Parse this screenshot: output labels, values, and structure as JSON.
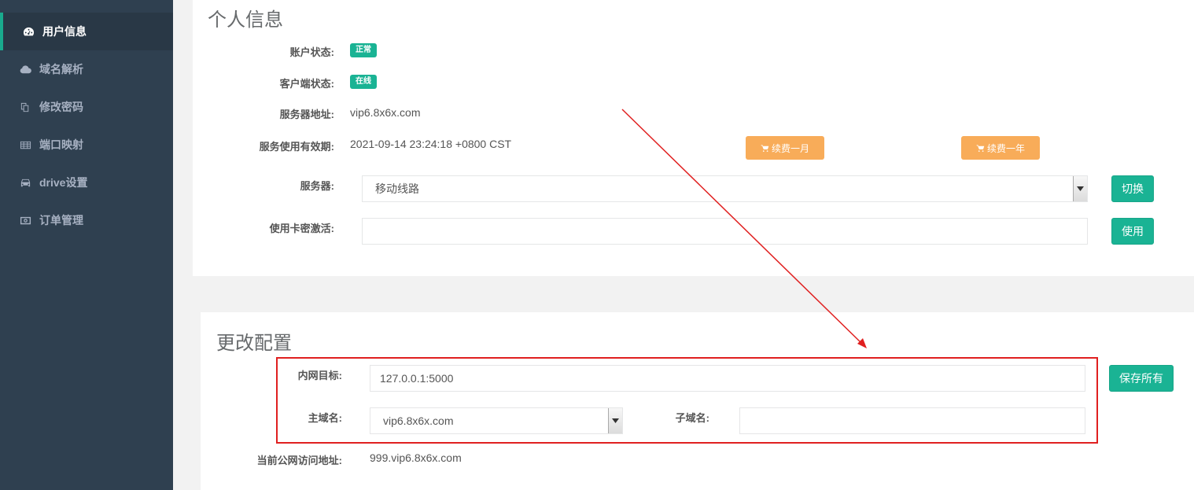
{
  "sidebar": {
    "items": [
      {
        "label": "用户信息",
        "icon": "dashboard-icon",
        "active": true
      },
      {
        "label": "域名解析",
        "icon": "cloud-icon"
      },
      {
        "label": "修改密码",
        "icon": "copy-icon"
      },
      {
        "label": "端口映射",
        "icon": "table-icon"
      },
      {
        "label": "drive设置",
        "icon": "car-icon"
      },
      {
        "label": "订单管理",
        "icon": "money-icon"
      }
    ]
  },
  "profile": {
    "title": "个人信息",
    "account_status_label": "账户状态:",
    "account_status_badge": "正常",
    "client_status_label": "客户端状态:",
    "client_status_badge": "在线",
    "server_address_label": "服务器地址:",
    "server_address": "vip6.8x6x.com",
    "expiry_label": "服务使用有效期:",
    "expiry": "2021-09-14 23:24:18 +0800 CST",
    "renew_month": "续费一月",
    "renew_year": "续费一年",
    "server_label": "服务器:",
    "server_selected": "移动线路",
    "switch_button": "切换",
    "card_label": "使用卡密激活:",
    "card_value": "",
    "use_button": "使用"
  },
  "config": {
    "title": "更改配置",
    "target_label": "内网目标:",
    "target_value": "127.0.0.1:5000",
    "save_button": "保存所有",
    "main_domain_label": "主域名:",
    "main_domain_selected": "vip6.8x6x.com",
    "subdomain_label": "子域名:",
    "subdomain_value": "",
    "public_url_label": "当前公网访问地址:",
    "public_url": "999.vip6.8x6x.com"
  },
  "colors": {
    "sidebar_bg": "#2f4050",
    "accent_green": "#1ab394",
    "accent_orange": "#f8ac59",
    "annotation_red": "#e02020"
  }
}
